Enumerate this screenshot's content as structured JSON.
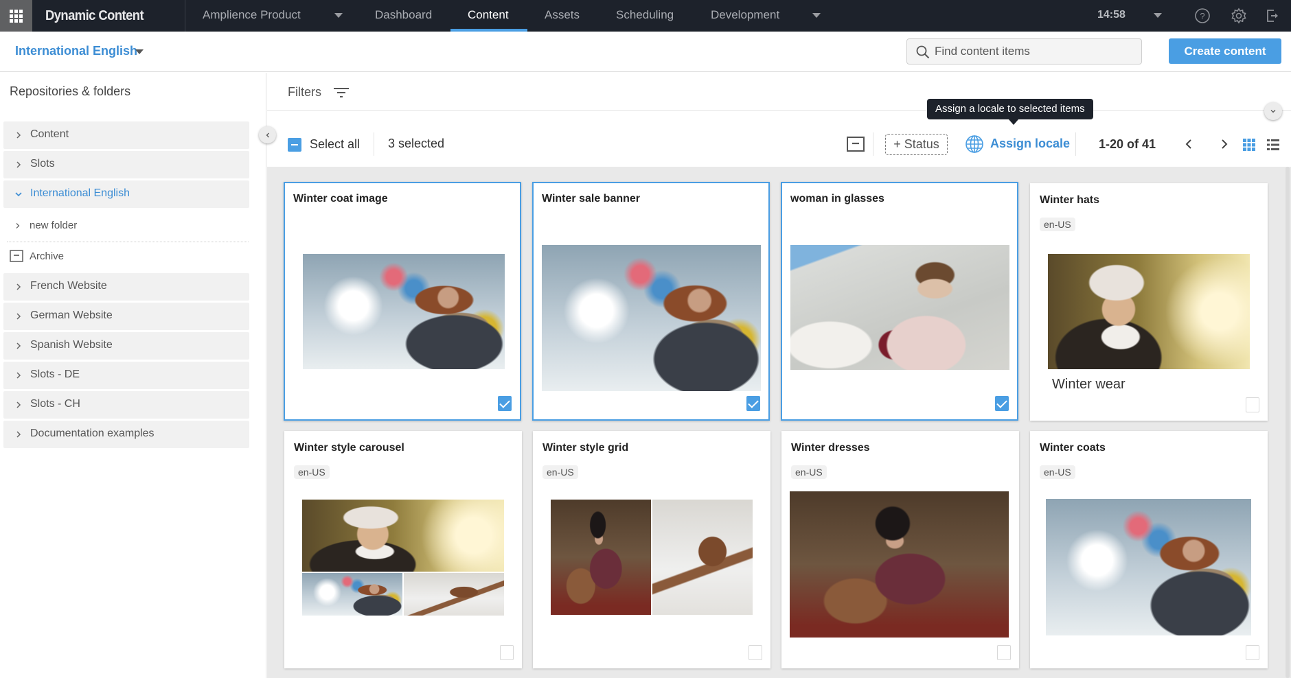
{
  "topbar": {
    "apps_icon": "apps-grid-icon",
    "brand": "Dynamic Content",
    "hub_name": "Amplience Product",
    "tabs": [
      {
        "label": "Dashboard",
        "active": false
      },
      {
        "label": "Content",
        "active": true
      },
      {
        "label": "Assets",
        "active": false
      },
      {
        "label": "Scheduling",
        "active": false
      },
      {
        "label": "Development",
        "active": false
      }
    ],
    "clock": "14:58",
    "icons": [
      "help-icon",
      "settings-gear-icon",
      "logout-icon"
    ]
  },
  "subheader": {
    "locale": "International English",
    "search_placeholder": "Find content items",
    "create_button": "Create content"
  },
  "sidebar": {
    "title": "Repositories & folders",
    "items": [
      {
        "label": "Content",
        "expanded": false
      },
      {
        "label": "Slots",
        "expanded": false
      },
      {
        "label": "International English",
        "expanded": true,
        "active": true
      },
      {
        "label": "French Website",
        "expanded": false
      },
      {
        "label": "German Website",
        "expanded": false
      },
      {
        "label": "Spanish Website",
        "expanded": false
      },
      {
        "label": "Slots - DE",
        "expanded": false
      },
      {
        "label": "Slots - CH",
        "expanded": false
      },
      {
        "label": "Documentation examples",
        "expanded": false
      }
    ],
    "subfolder": "new folder",
    "archive": "Archive"
  },
  "main": {
    "filters_label": "Filters",
    "select_all": "Select all",
    "selected_count": "3 selected",
    "status_button": "+ Status",
    "assign_locale": "Assign locale",
    "tooltip": "Assign a locale to selected items",
    "page_range": "1-20 of 41"
  },
  "colors": {
    "accent": "#4a9ee3",
    "topbar": "#1d222b",
    "link": "#3c8dd4"
  },
  "cards": [
    {
      "title": "Winter coat image",
      "locale": null,
      "selected": true,
      "image": "woman in snow with fur hood"
    },
    {
      "title": "Winter sale banner",
      "locale": null,
      "selected": true,
      "image": "woman in snow with fur hood"
    },
    {
      "title": "woman in glasses",
      "locale": null,
      "selected": true,
      "image": "woman in sunglasses with shopping bags"
    },
    {
      "title": "Winter hats",
      "locale": "en-US",
      "selected": false,
      "image": "woman in knit hat",
      "caption": "Winter wear"
    },
    {
      "title": "Winter style carousel",
      "locale": "en-US",
      "selected": false,
      "image": "collage: knit hat, snow coat, boot"
    },
    {
      "title": "Winter style grid",
      "locale": "en-US",
      "selected": false,
      "image": "grid: striped dress, boot in snow"
    },
    {
      "title": "Winter dresses",
      "locale": "en-US",
      "selected": false,
      "image": "woman in striped dress and hat"
    },
    {
      "title": "Winter coats",
      "locale": "en-US",
      "selected": false,
      "image": "woman in snow with fur hood"
    }
  ]
}
